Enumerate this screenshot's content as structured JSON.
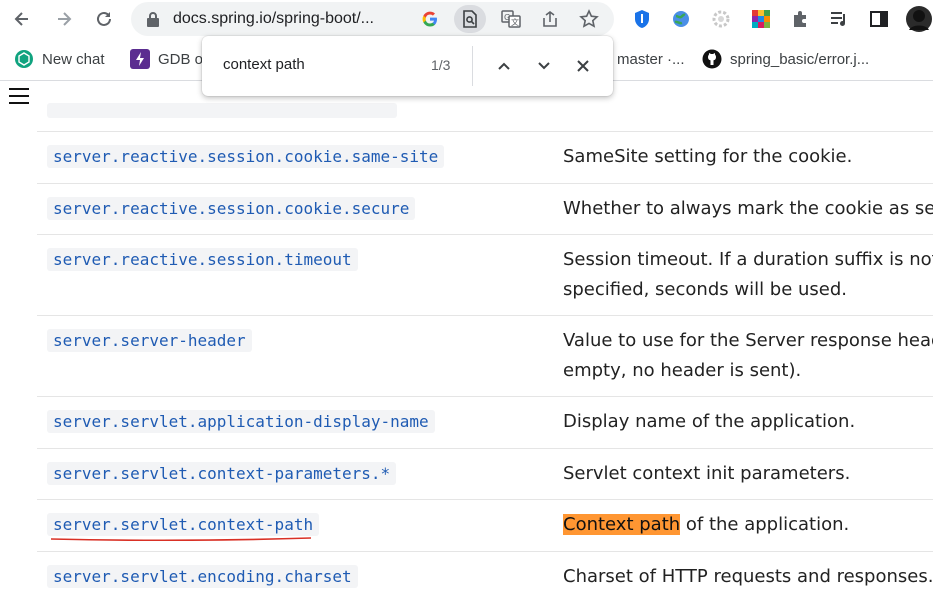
{
  "browser": {
    "url": "docs.spring.io/spring-boot/...",
    "bookmarks": [
      {
        "label": "New chat"
      },
      {
        "label": "GDB o"
      },
      {
        "label": "master ·..."
      },
      {
        "label": "spring_basic/error.j..."
      }
    ]
  },
  "find_bar": {
    "query": "context path",
    "count": "1/3"
  },
  "table": {
    "rows": [
      {
        "property": "server.reactive.session.cookie.same-site",
        "description": [
          "SameSite setting for the cookie."
        ]
      },
      {
        "property": "server.reactive.session.cookie.secure",
        "description": [
          "Whether to always mark the cookie as secure"
        ]
      },
      {
        "property": "server.reactive.session.timeout",
        "description": [
          "Session timeout. If a duration suffix is not",
          "specified, seconds will be used."
        ]
      },
      {
        "property": "server.server-header",
        "description": [
          "Value to use for the Server response header (",
          "empty, no header is sent)."
        ]
      },
      {
        "property": "server.servlet.application-display-name",
        "description": [
          "Display name of the application."
        ]
      },
      {
        "property": "server.servlet.context-parameters.*",
        "description": [
          "Servlet context init parameters."
        ]
      },
      {
        "property": "server.servlet.context-path",
        "description_highlight": "Context path",
        "description_rest": " of the application."
      },
      {
        "property": "server.servlet.encoding.charset",
        "description": [
          "Charset of HTTP requests and responses."
        ]
      }
    ]
  },
  "colors": {
    "code_text": "#1f5bb3",
    "code_bg": "#f3f4f6",
    "find_highlight": "#ff9632",
    "spell_underline": "#d93025"
  }
}
